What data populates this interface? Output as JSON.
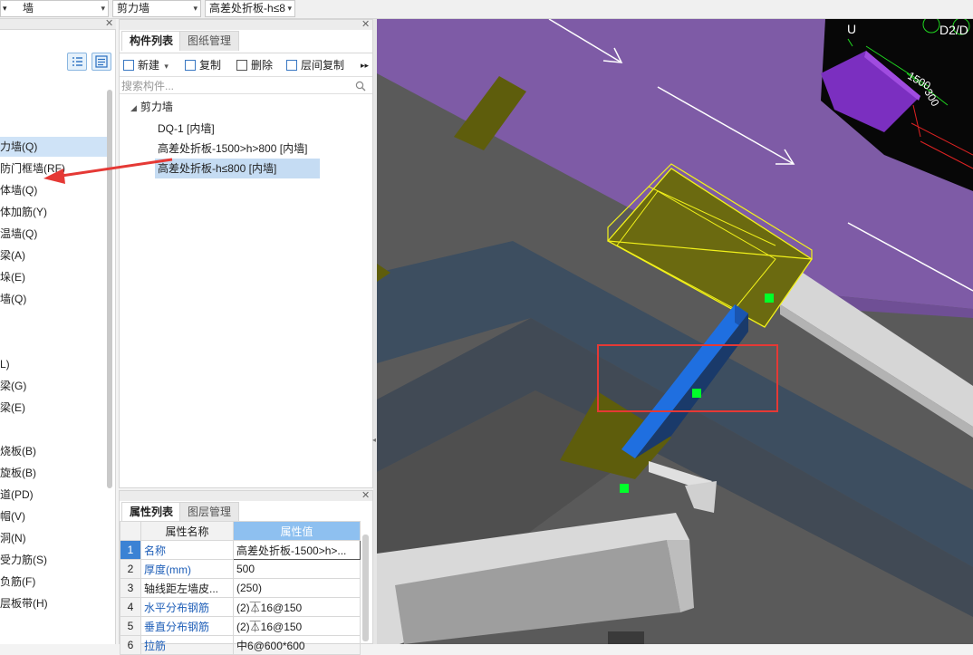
{
  "toolbar": {
    "combo1": "墙",
    "combo2": "剪力墙",
    "combo3": "高差处折板-h≤8"
  },
  "left_tree": {
    "items": [
      {
        "label": "力墙(Q)",
        "selected": true
      },
      {
        "label": "防门框墙(RF)"
      },
      {
        "label": "体墙(Q)"
      },
      {
        "label": "体加筋(Y)"
      },
      {
        "label": "温墙(Q)"
      },
      {
        "label": "梁(A)"
      },
      {
        "label": "垛(E)"
      },
      {
        "label": "墙(Q)"
      },
      {
        "label": "L)"
      },
      {
        "label": "梁(G)"
      },
      {
        "label": "梁(E)"
      },
      {
        "label": "烧板(B)"
      },
      {
        "label": "旋板(B)"
      },
      {
        "label": "道(PD)"
      },
      {
        "label": "帽(V)"
      },
      {
        "label": "洞(N)"
      },
      {
        "label": "受力筋(S)"
      },
      {
        "label": "负筋(F)"
      },
      {
        "label": "层板带(H)"
      }
    ]
  },
  "component_panel": {
    "tabs": [
      "构件列表",
      "图纸管理"
    ],
    "toolbar": {
      "new": "新建",
      "copy": "复制",
      "delete": "删除",
      "floor_copy": "层间复制",
      "more": "▸▸"
    },
    "search_placeholder": "搜索构件...",
    "tree": {
      "group": "剪力墙",
      "items": [
        {
          "label": "DQ-1 [内墙]"
        },
        {
          "label": "高差处折板-1500>h>800 [内墙]"
        },
        {
          "label": "高差处折板-h≤800 [内墙]",
          "selected": true
        }
      ]
    }
  },
  "properties_panel": {
    "tabs": [
      "属性列表",
      "图层管理"
    ],
    "headers": {
      "name": "属性名称",
      "value": "属性值"
    },
    "rows": [
      {
        "num": "1",
        "name": "名称",
        "value": "高差处折板-1500>h>...",
        "blue": true
      },
      {
        "num": "2",
        "name": "厚度(mm)",
        "value": "500",
        "blue": true
      },
      {
        "num": "3",
        "name": "轴线距左墙皮...",
        "value": "(250)",
        "blue": false
      },
      {
        "num": "4",
        "name": "水平分布钢筋",
        "value": "(2)⏄16@150",
        "blue": true
      },
      {
        "num": "5",
        "name": "垂直分布钢筋",
        "value": "(2)⏄16@150",
        "blue": true
      },
      {
        "num": "6",
        "name": "拉筋",
        "value": "中6@600*600",
        "blue": true
      }
    ]
  },
  "viewport": {
    "dim_1500": "1500",
    "dim_300": "300",
    "corner_label": "D2/D",
    "corner_u": "U"
  },
  "colors": {
    "annotation_red": "#e53935",
    "slab_purple": "#7e5ba6",
    "wall_blue": "#1f6fe0",
    "selection_yellow": "#f2f21a",
    "marker_green": "#00ff2a",
    "ground_dark": "#5a5a5a",
    "strip_navy": "#3d4e60"
  }
}
